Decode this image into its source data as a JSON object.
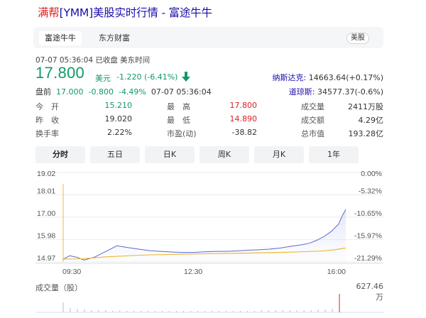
{
  "header": {
    "title_highlight": "满帮",
    "title_rest": "[YMM]美股实时行情 - 富途牛牛"
  },
  "source_tabs": [
    {
      "label": "富途牛牛",
      "active": true
    },
    {
      "label": "东方财富",
      "active": false
    }
  ],
  "market_tag": "美股",
  "meta": "07-07 05:36:04  已收盘  美东时间",
  "quote": {
    "price": "17.800",
    "unit": "美元",
    "change": "-1.220 (-6.41%)",
    "direction": "down",
    "color": "#0f9a66"
  },
  "indices": [
    {
      "name": "纳斯达克:",
      "value": "14663.64(+0.17%)"
    },
    {
      "name": "道琼斯:",
      "value": "34577.37(-0.6%)"
    }
  ],
  "premarket": {
    "label": "盘前",
    "price": "17.000",
    "change": "-0.800",
    "pct": "-4.49%",
    "time": "07-07 05:36:04"
  },
  "stats": [
    {
      "label": "今　开",
      "value": "15.210",
      "color": "green"
    },
    {
      "label": "最　高",
      "value": "17.800",
      "color": "red"
    },
    {
      "label": "成交量",
      "value": "2411万股",
      "color": "none"
    },
    {
      "label": "昨　收",
      "value": "19.020",
      "color": "none"
    },
    {
      "label": "最　低",
      "value": "14.890",
      "color": "red"
    },
    {
      "label": "成交额",
      "value": "4.29亿",
      "color": "none"
    },
    {
      "label": "换手率",
      "value": "2.22%",
      "color": "none"
    },
    {
      "label": "市盈(动)",
      "value": "-38.82",
      "color": "none"
    },
    {
      "label": "总市值",
      "value": "193.28亿",
      "color": "none"
    }
  ],
  "period_tabs": [
    {
      "label": "分时",
      "active": true
    },
    {
      "label": "五日",
      "active": false
    },
    {
      "label": "日K",
      "active": false
    },
    {
      "label": "周K",
      "active": false
    },
    {
      "label": "月K",
      "active": false
    },
    {
      "label": "1年",
      "active": false
    }
  ],
  "volume": {
    "label": "成交量（股）",
    "max": "627.46万"
  },
  "chart_data": {
    "type": "line",
    "y_ticks": [
      "19.02",
      "18.01",
      "17.00",
      "15.98",
      "14.97"
    ],
    "y_tick_values": [
      19.02,
      18.01,
      17.0,
      15.98,
      14.97
    ],
    "pct_ticks": [
      "0.00%",
      "-5.32%",
      "-10.65%",
      "-15.97%",
      "-21.29%"
    ],
    "x_ticks": [
      "09:30",
      "12:30",
      "16:00"
    ],
    "ylim": [
      14.97,
      19.02
    ],
    "grid": true,
    "series": [
      {
        "color": "#5b6ad0",
        "x": [
          "09:30",
          "09:40",
          "09:50",
          "10:00",
          "10:15",
          "10:30",
          "10:45",
          "11:00",
          "11:15",
          "11:30",
          "11:45",
          "12:00",
          "12:15",
          "12:30",
          "12:45",
          "13:00",
          "13:15",
          "13:30",
          "13:45",
          "14:00",
          "14:15",
          "14:30",
          "14:45",
          "15:00",
          "15:10",
          "15:20",
          "15:30",
          "15:40",
          "15:50",
          "15:55",
          "16:00"
        ],
        "values": [
          15.08,
          15.25,
          15.18,
          15.05,
          15.2,
          15.45,
          15.7,
          15.62,
          15.55,
          15.48,
          15.45,
          15.42,
          15.4,
          15.4,
          15.43,
          15.45,
          15.45,
          15.47,
          15.5,
          15.52,
          15.55,
          15.6,
          15.68,
          15.75,
          15.82,
          15.95,
          16.12,
          16.35,
          16.68,
          17.05,
          17.35
        ]
      },
      {
        "color": "#f0b93a",
        "x": [
          "09:30",
          "09:45",
          "10:00",
          "10:30",
          "11:00",
          "11:30",
          "12:00",
          "12:30",
          "13:00",
          "13:30",
          "14:00",
          "14:30",
          "15:00",
          "15:30",
          "15:45",
          "16:00"
        ],
        "values": [
          15.1,
          15.1,
          15.12,
          15.2,
          15.25,
          15.29,
          15.31,
          15.33,
          15.35,
          15.36,
          15.38,
          15.4,
          15.43,
          15.47,
          15.52,
          15.6
        ]
      }
    ]
  }
}
